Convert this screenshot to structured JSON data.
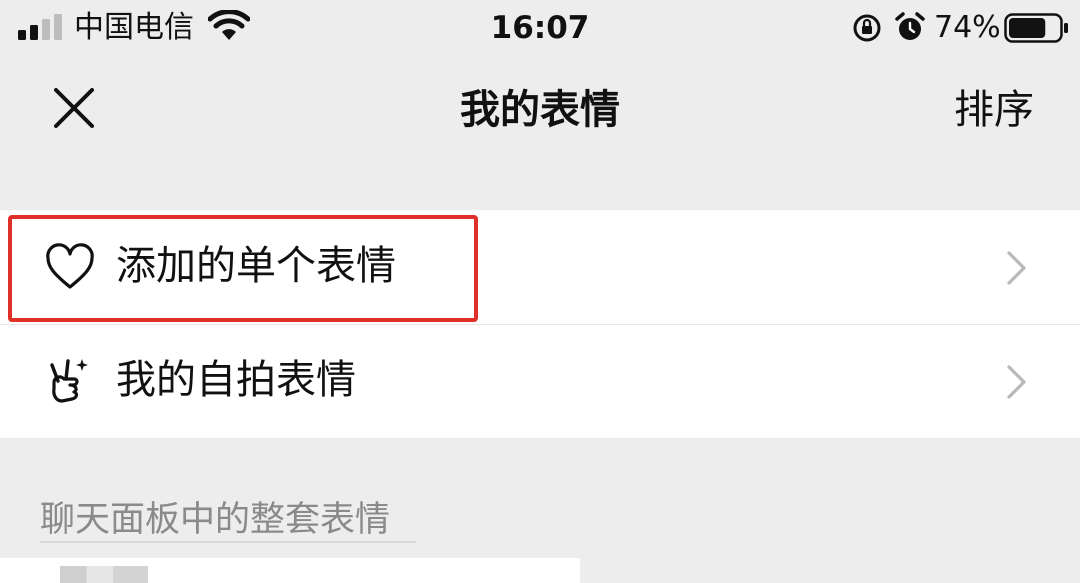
{
  "status_bar": {
    "carrier": "中国电信",
    "time": "16:07",
    "battery_percent": "74%",
    "battery_level": 0.74,
    "icons": [
      "signal-icon",
      "wifi-icon",
      "rotation-lock-icon",
      "alarm-icon",
      "battery-icon"
    ]
  },
  "nav": {
    "title": "我的表情",
    "sort_label": "排序",
    "close_icon": "close-icon"
  },
  "list": {
    "items": [
      {
        "label": "添加的单个表情",
        "icon": "heart-icon",
        "highlighted": true
      },
      {
        "label": "我的自拍表情",
        "icon": "selfie-hand-icon",
        "highlighted": false
      }
    ]
  },
  "section": {
    "header": "聊天面板中的整套表情"
  },
  "colors": {
    "background": "#ededed",
    "card": "#ffffff",
    "highlight": "#e0302a",
    "section_text": "#8a8a8a"
  }
}
